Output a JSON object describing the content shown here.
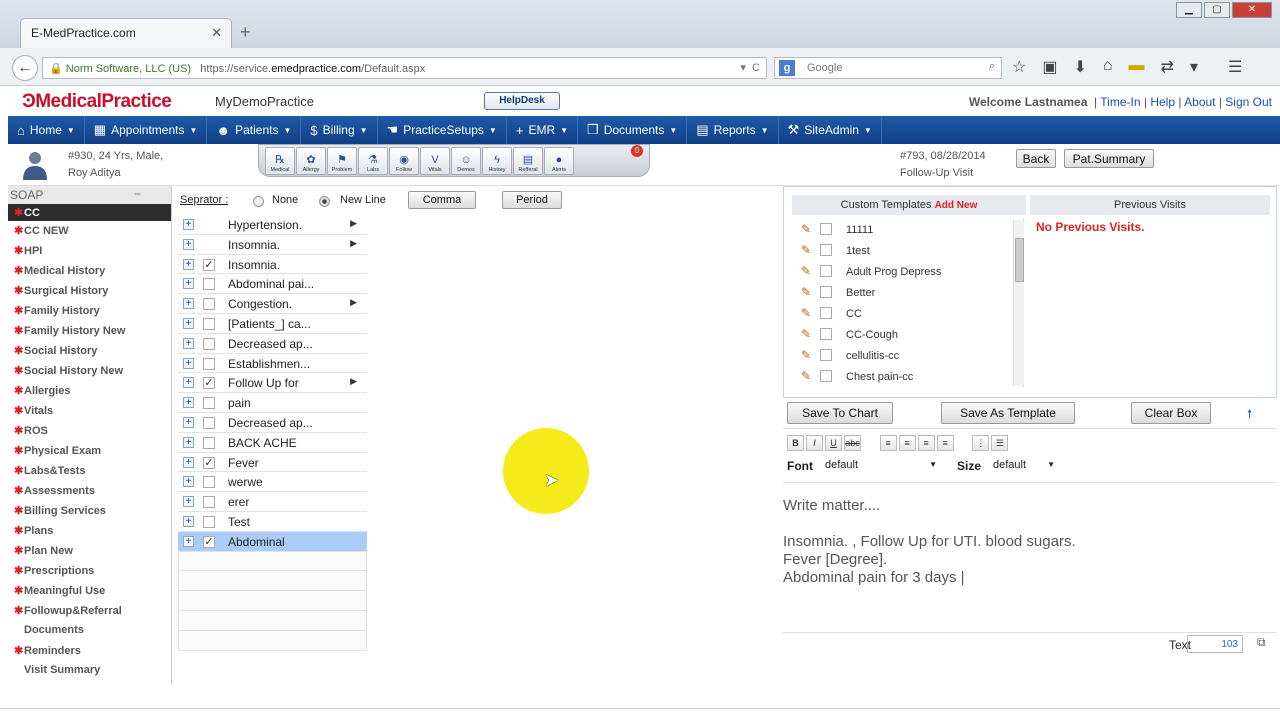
{
  "browser": {
    "tab_title": "E-MedPractice.com",
    "url_org": "Norm Software, LLC (US)",
    "url_prefix": "https://service.",
    "url_domain": "emedpractice.com",
    "url_path": "/Default.aspx",
    "search_placeholder": "Google"
  },
  "header": {
    "logo": "MedicalPractice",
    "practice": "MyDemoPractice",
    "helpdesk": "HelpDesk",
    "welcome": "Welcome Lastnamea",
    "links": [
      "Time-In",
      "Help",
      "About",
      "Sign Out"
    ]
  },
  "menu": [
    {
      "label": "Home",
      "icon": "home-icon"
    },
    {
      "label": "Appointments",
      "icon": "calendar-icon"
    },
    {
      "label": "Patients",
      "icon": "patient-icon"
    },
    {
      "label": "Billing",
      "icon": "dollar-icon"
    },
    {
      "label": "PracticeSetups",
      "icon": "hand-icon"
    },
    {
      "label": "EMR",
      "icon": "plus-icon"
    },
    {
      "label": "Documents",
      "icon": "folder-icon"
    },
    {
      "label": "Reports",
      "icon": "report-icon"
    },
    {
      "label": "SiteAdmin",
      "icon": "admin-icon"
    }
  ],
  "patient": {
    "line1": "#930, 24 Yrs, Male,",
    "line2": "Roy Aditya"
  },
  "toolbox": [
    {
      "label": "Medical",
      "glyph": "℞"
    },
    {
      "label": "Allergy",
      "glyph": "✿"
    },
    {
      "label": "Problem",
      "glyph": "⚑"
    },
    {
      "label": "Labs",
      "glyph": "⚗"
    },
    {
      "label": "Follow",
      "glyph": "◉"
    },
    {
      "label": "Vitals",
      "glyph": "V"
    },
    {
      "label": "Demos",
      "glyph": "☺"
    },
    {
      "label": "History",
      "glyph": "ϟ"
    },
    {
      "label": "Refferal",
      "glyph": "▤"
    },
    {
      "label": "Alerts",
      "glyph": "●"
    }
  ],
  "alert_count": "0",
  "visit": {
    "line1": "#793, 08/28/2014",
    "line2": "Follow-Up Visit"
  },
  "buttons": {
    "back": "Back",
    "pat_summary": "Pat.Summary",
    "comma": "Comma",
    "period": "Period",
    "save_chart": "Save To Chart",
    "save_template": "Save As Template",
    "clear_box": "Clear Box"
  },
  "soap": {
    "title": "SOAP",
    "items": [
      {
        "label": "CC",
        "star": true,
        "active": true
      },
      {
        "label": "CC NEW",
        "star": true
      },
      {
        "label": "HPI",
        "star": true
      },
      {
        "label": "Medical History",
        "star": true
      },
      {
        "label": "Surgical History",
        "star": true
      },
      {
        "label": "Family History",
        "star": true
      },
      {
        "label": "Family History New",
        "star": true
      },
      {
        "label": "Social History",
        "star": true
      },
      {
        "label": "Social History New",
        "star": true
      },
      {
        "label": "Allergies",
        "star": true
      },
      {
        "label": "Vitals",
        "star": true
      },
      {
        "label": "ROS",
        "star": true
      },
      {
        "label": "Physical Exam",
        "star": true
      },
      {
        "label": "Labs&Tests",
        "star": true
      },
      {
        "label": "Assessments",
        "star": true
      },
      {
        "label": "Billing Services",
        "star": true
      },
      {
        "label": "Plans",
        "star": true
      },
      {
        "label": "Plan New",
        "star": true
      },
      {
        "label": "Prescriptions",
        "star": true
      },
      {
        "label": "Meaningful Use",
        "star": true
      },
      {
        "label": "Followup&Referral",
        "star": true
      },
      {
        "label": "Documents",
        "star": false
      },
      {
        "label": "Reminders",
        "star": true
      },
      {
        "label": "Visit Summary",
        "star": false
      }
    ]
  },
  "separator": {
    "label": "Seprator :",
    "options": [
      "None",
      "New Line"
    ],
    "selected": "New Line"
  },
  "items": [
    {
      "label": "Hypertension.",
      "checkbox": false,
      "checked": false,
      "arrow": true
    },
    {
      "label": "Insomnia.",
      "checkbox": false,
      "checked": false,
      "arrow": true
    },
    {
      "label": "Insomnia.",
      "checkbox": true,
      "checked": true,
      "arrow": false
    },
    {
      "label": "Abdominal pai...",
      "checkbox": true,
      "checked": false,
      "arrow": false
    },
    {
      "label": "Congestion.",
      "checkbox": true,
      "checked": false,
      "arrow": true
    },
    {
      "label": "[Patients_] ca...",
      "checkbox": true,
      "checked": false,
      "arrow": false
    },
    {
      "label": "Decreased ap...",
      "checkbox": true,
      "checked": false,
      "arrow": false
    },
    {
      "label": "Establishmen...",
      "checkbox": true,
      "checked": false,
      "arrow": false
    },
    {
      "label": "Follow Up for",
      "checkbox": true,
      "checked": true,
      "arrow": true
    },
    {
      "label": "pain",
      "checkbox": true,
      "checked": false,
      "arrow": false
    },
    {
      "label": "Decreased ap...",
      "checkbox": true,
      "checked": false,
      "arrow": false
    },
    {
      "label": "BACK ACHE",
      "checkbox": true,
      "checked": false,
      "arrow": false
    },
    {
      "label": "Fever",
      "checkbox": true,
      "checked": true,
      "arrow": false
    },
    {
      "label": "werwe",
      "checkbox": true,
      "checked": false,
      "arrow": false
    },
    {
      "label": "erer",
      "checkbox": true,
      "checked": false,
      "arrow": false
    },
    {
      "label": "Test",
      "checkbox": true,
      "checked": false,
      "arrow": false
    },
    {
      "label": "Abdominal",
      "checkbox": true,
      "checked": true,
      "arrow": false,
      "selected": true
    }
  ],
  "templates": {
    "title": "Custom Templates",
    "add": "Add New",
    "items": [
      "11111",
      "1test",
      "Adult Prog Depress",
      "Better",
      "CC",
      "CC-Cough",
      "cellulitis-cc",
      "Chest pain-cc"
    ]
  },
  "previous": {
    "title": "Previous Visits",
    "empty": "No Previous Visits."
  },
  "editor": {
    "font_label": "Font",
    "font_value": "default",
    "size_label": "Size",
    "size_value": "default",
    "lines": [
      "Write matter....",
      "",
      "Insomnia. , Follow Up for UTI. blood sugars.",
      "Fever [Degree].",
      "Abdominal pain for 3 days |"
    ],
    "text_label": "Text",
    "text_count": "103"
  }
}
